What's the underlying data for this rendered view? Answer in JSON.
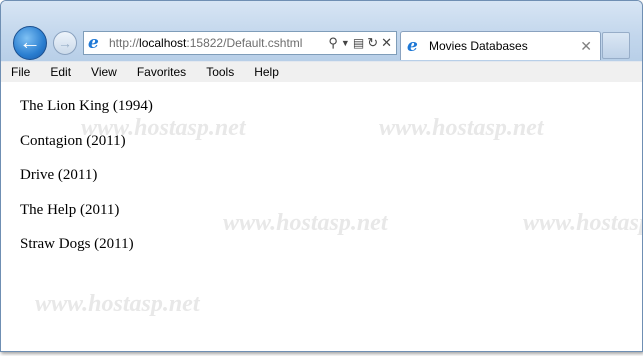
{
  "browser": {
    "address": {
      "scheme": "http://",
      "host": "localhost",
      "rest": ":15822/Default.cshtml"
    },
    "tab": {
      "title": "Movies Databases"
    }
  },
  "menu": [
    "File",
    "Edit",
    "View",
    "Favorites",
    "Tools",
    "Help"
  ],
  "movies": [
    "The Lion King (1994)",
    "Contagion (2011)",
    "Drive (2011)",
    "The Help (2011)",
    "Straw Dogs (2011)"
  ],
  "watermark": "www.hostasp.net",
  "colors": {
    "chrome": "#c2d6ec",
    "back_button": "#2a7ed0"
  }
}
